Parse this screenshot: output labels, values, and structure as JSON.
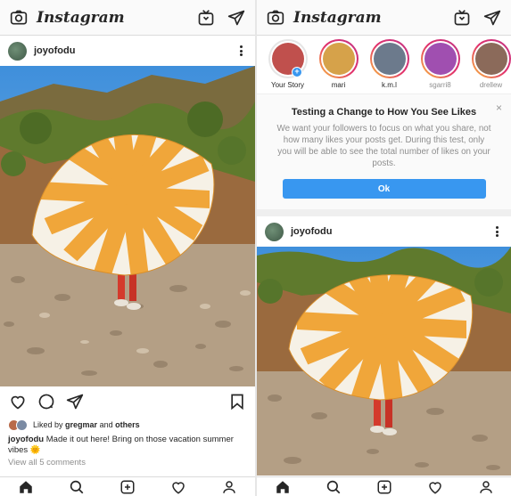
{
  "app": {
    "logo": "Instagram"
  },
  "left": {
    "post": {
      "username": "joyofodu",
      "liked_by_prefix": "Liked by ",
      "liked_by_user": "gregmar",
      "liked_by_mid": " and ",
      "liked_by_rest": "others",
      "caption_user": "joyofodu",
      "caption_text": " Made it out here! Bring on those vacation summer vibes 🌞",
      "view_comments": "View all 5 comments"
    }
  },
  "right": {
    "stories": [
      {
        "label": "Your Story",
        "own": true,
        "color": "#c0504d"
      },
      {
        "label": "mari",
        "own": false,
        "color": "#d6a24a"
      },
      {
        "label": "k.m.l",
        "own": false,
        "color": "#6c7a8c"
      },
      {
        "label": "sgarri8",
        "own": false,
        "color": "#a04fb0"
      },
      {
        "label": "drellew",
        "own": false,
        "color": "#8b6a5a"
      }
    ],
    "notice": {
      "title": "Testing a Change to How You See Likes",
      "body": "We want your followers to focus on what you share, not how many likes your posts get. During this test, only you will be able to see the total number of likes on your posts.",
      "ok_label": "Ok",
      "close": "×"
    },
    "post": {
      "username": "joyofodu"
    }
  },
  "icons": {
    "camera": "camera-icon",
    "igtv": "igtv-icon",
    "direct": "direct-message-icon",
    "heart": "heart-icon",
    "comment": "comment-icon",
    "share": "share-icon",
    "bookmark": "bookmark-icon",
    "home": "home-icon",
    "search": "search-icon",
    "add": "add-post-icon",
    "activity": "activity-heart-icon",
    "profile": "profile-icon"
  },
  "colors": {
    "accent": "#3897f0",
    "text": "#262626",
    "muted": "#8e8e8e"
  }
}
